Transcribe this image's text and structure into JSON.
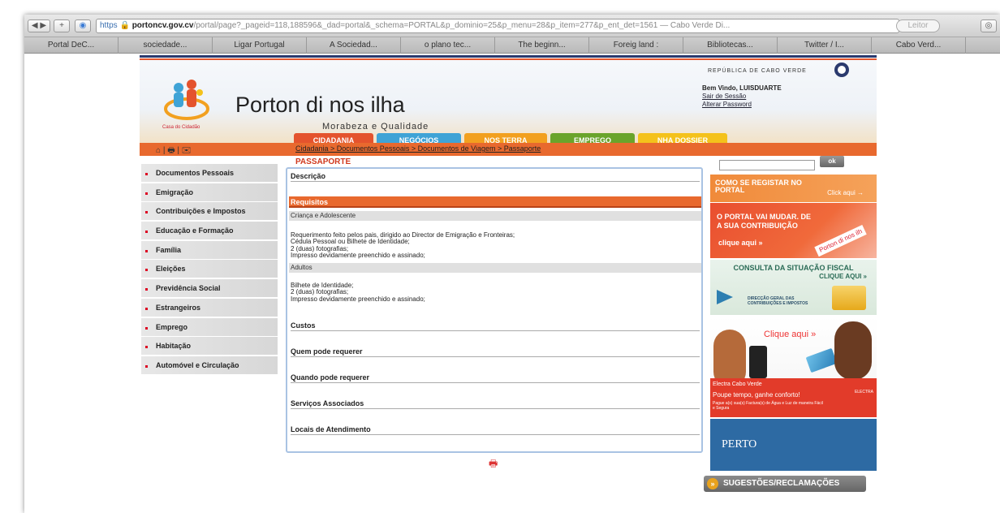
{
  "browser": {
    "url_https": "https",
    "url_host": "portoncv.gov.cv",
    "url_path": "/portal/page?_pageid=118,188596&_dad=portal&_schema=PORTAL&p_dominio=25&p_menu=28&p_item=277&p_ent_det=1561",
    "title_tail": "— Cabo Verde Di...",
    "reader": "Leitor",
    "tabs": [
      "Portal DeC...",
      "sociedade...",
      "Ligar Portugal",
      "A Sociedad...",
      "o plano tec...",
      "The beginn...",
      "Foreig land :",
      "Bibliotecas...",
      "Twitter / I...",
      "Cabo Verd..."
    ]
  },
  "header": {
    "republica": "REPÚBLICA DE CABO VERDE",
    "title": "Porton di nos ilha",
    "subtitle": "Morabeza e Qualidade",
    "casa": "Casa do Cidadão",
    "welcome_prefix": "Bem Vindo, ",
    "welcome_user": "LUISDUARTE",
    "logout": "Sair de Sessão",
    "change_password": "Alterar Password"
  },
  "nav": {
    "tabs": [
      {
        "label": "CIDADANIA",
        "color": "#e4532d"
      },
      {
        "label": "NEGÓCIOS",
        "color": "#3fa3d6"
      },
      {
        "label": "NOS TERRA",
        "color": "#f2a01f"
      },
      {
        "label": "EMPREGO",
        "color": "#6aa42b"
      },
      {
        "label": "NHA DOSSIER",
        "color": "#f4c21b"
      }
    ],
    "breadcrumb": "Cidadania > Documentos Pessoais > Documentos de Viagem > Passaporte",
    "small_icons": "⌂ | 🖶 | ✉"
  },
  "sidebar": {
    "items": [
      "Documentos Pessoais",
      "Emigração",
      "Contribuições e Impostos",
      "Educação e Formação",
      "Família",
      "Eleições",
      "Previdência Social",
      "Estrangeiros",
      "Emprego",
      "Habitação",
      "Automóvel e Circulação"
    ]
  },
  "content": {
    "title": "PASSAPORTE",
    "descricao": "Descrição",
    "requisitos": "Requisitos",
    "crianca": "Criança e Adolescente",
    "crianca_lines": [
      "Requerimento feito pelos pais, dirigido ao Director de Emigração e Fronteiras;",
      "Cédula Pessoal ou Bilhete de Identidade;",
      "2 (duas) fotografias;",
      "Impresso devidamente preenchido e assinado;"
    ],
    "adultos": "Adultos",
    "adultos_lines": [
      "Bilhete de Identidade;",
      "2 (duas) fotografias;",
      "Impresso devidamente preenchido e assinado;"
    ],
    "custos": "Custos",
    "quem": "Quem pode requerer",
    "quando": "Quando pode requerer",
    "servicos": "Serviços Associados",
    "locais": "Locais de Atendimento"
  },
  "right": {
    "search_placeholder": "",
    "ok": "ok",
    "banner1_title": "COMO SE REGISTAR NO PORTAL",
    "banner1_click": "Click aqui →",
    "banner2_title": "O PORTAL VAI MUDAR. DE A SUA CONTRIBUIÇÃO",
    "banner2_click": "clique aqui »",
    "banner2_logo": "Porton di nos ilh",
    "banner3_title": "CONSULTA DA SITUAÇÃO FISCAL",
    "banner3_click": "CLIQUE AQUI »",
    "banner3_org": "DIRECÇÃO GERAL DAS CONTRIBUIÇÕES E IMPOSTOS",
    "banner4_click": "Clique aqui »",
    "banner4_brand": "Electra  Cabo Verde",
    "banner4_slogan": "Poupe tempo, ganhe conforto!",
    "banner4_line": "Pague a(s) sua(s) Factura(s) de Água e Luz de maneira Fácil e Segura",
    "banner4_logo": "ELECTRA",
    "banner5": "PERTO",
    "sugestoes": "SUGESTÕES/RECLAMAÇÕES"
  }
}
